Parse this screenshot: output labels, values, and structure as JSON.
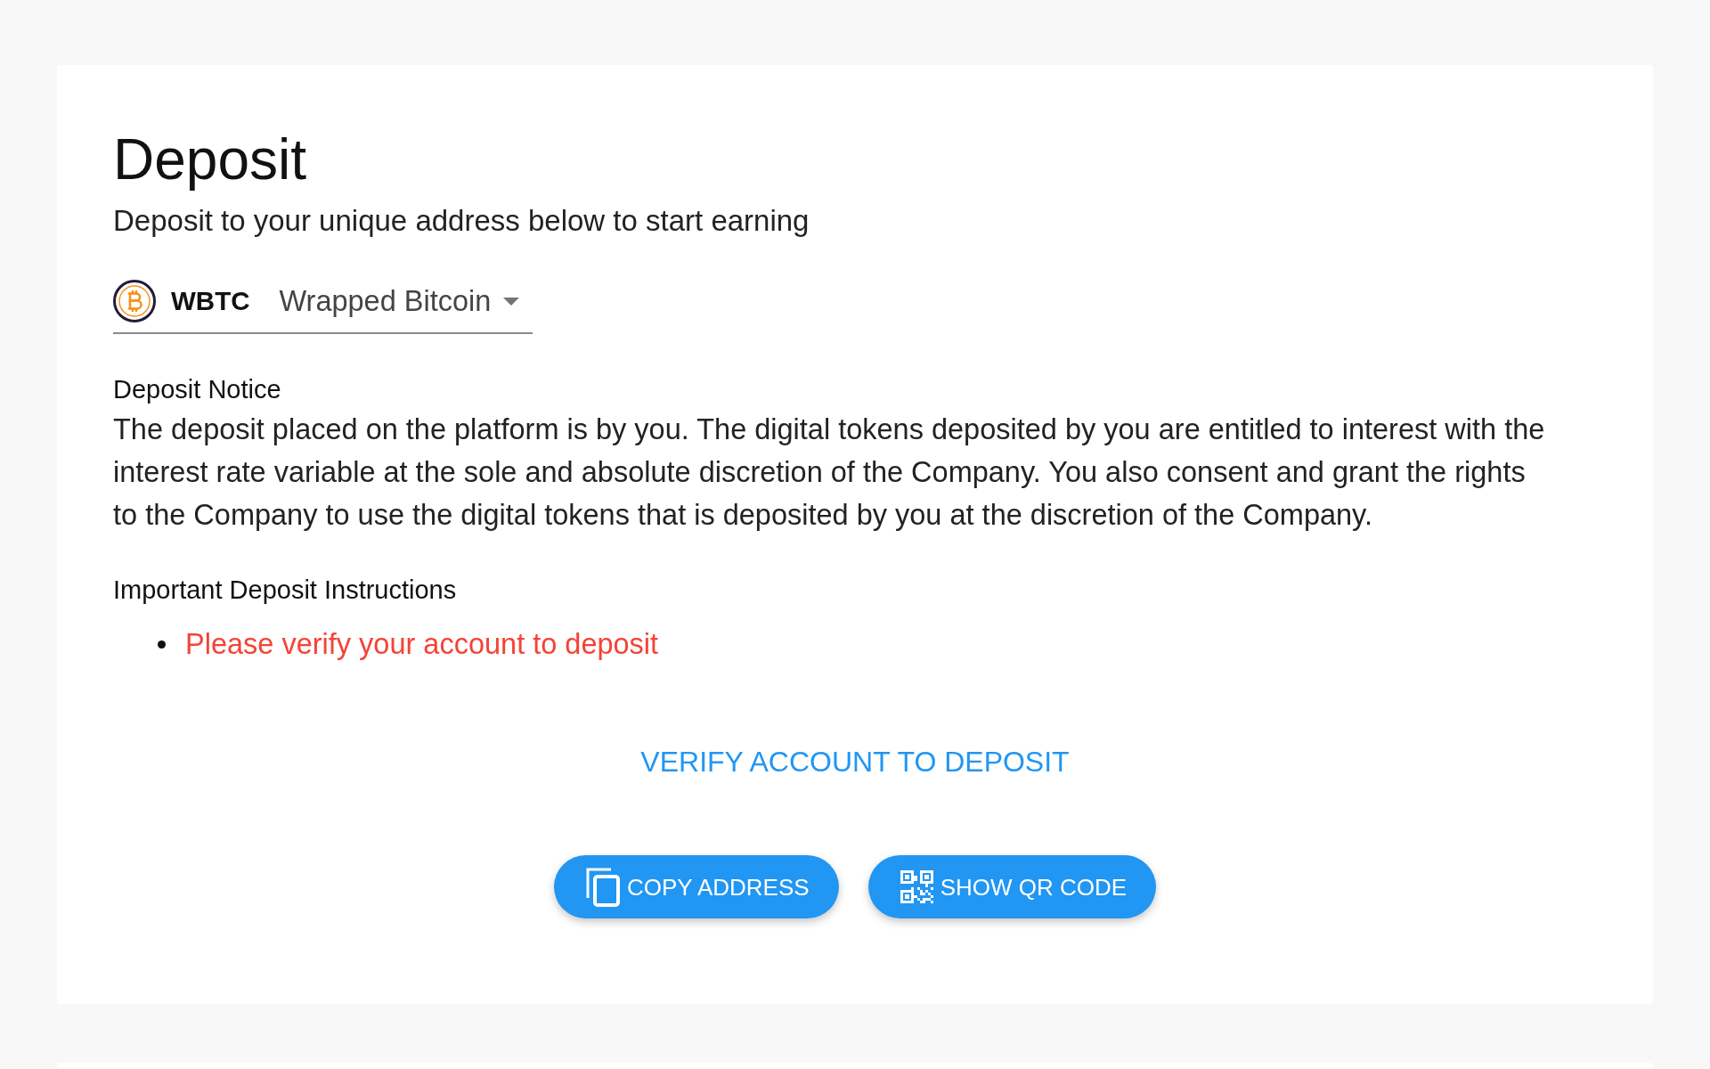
{
  "header": {
    "title": "Deposit",
    "subtitle": "Deposit to your unique address below to start earning"
  },
  "coin_select": {
    "symbol": "WBTC",
    "name": "Wrapped Bitcoin"
  },
  "notice": {
    "heading": "Deposit Notice",
    "text": "The deposit placed on the platform is by you. The digital tokens deposited by you are entitled to interest with the interest rate variable at the sole and absolute discretion of the Company. You also consent and grant the rights to the Company to use the digital tokens that is deposited by you at the discretion of the Company."
  },
  "instructions": {
    "heading": "Important Deposit Instructions",
    "items": [
      "Please verify your account to deposit"
    ]
  },
  "verify_link": "VERIFY ACCOUNT TO DEPOSIT",
  "buttons": [
    {
      "kind": "copy",
      "label": "COPY ADDRESS"
    },
    {
      "kind": "qr",
      "label": "SHOW QR CODE"
    }
  ]
}
